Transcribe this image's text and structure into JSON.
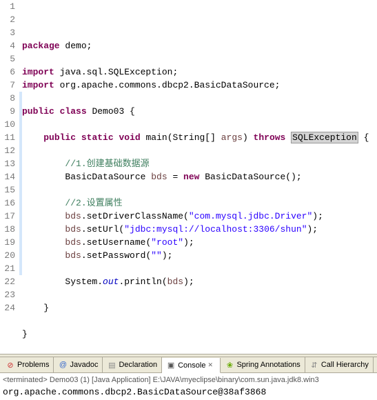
{
  "code": {
    "lines": [
      {
        "n": "1",
        "segs": [
          {
            "t": "package",
            "c": "kw"
          },
          {
            "t": " demo;"
          }
        ]
      },
      {
        "n": "2",
        "segs": []
      },
      {
        "n": "3",
        "segs": [
          {
            "t": "import",
            "c": "kw"
          },
          {
            "t": " java.sql.SQLException;"
          }
        ]
      },
      {
        "n": "4",
        "segs": [
          {
            "t": "import",
            "c": "kw"
          },
          {
            "t": " org.apache.commons.dbcp2.BasicDataSource;"
          }
        ]
      },
      {
        "n": "5",
        "segs": []
      },
      {
        "n": "6",
        "segs": [
          {
            "t": "public",
            "c": "kw"
          },
          {
            "t": " "
          },
          {
            "t": "class",
            "c": "kw"
          },
          {
            "t": " Demo03 {"
          }
        ]
      },
      {
        "n": "7",
        "segs": []
      },
      {
        "n": "8",
        "segs": [
          {
            "t": "    "
          },
          {
            "t": "public",
            "c": "kw"
          },
          {
            "t": " "
          },
          {
            "t": "static",
            "c": "kw"
          },
          {
            "t": " "
          },
          {
            "t": "void",
            "c": "kw"
          },
          {
            "t": " main(String[] "
          },
          {
            "t": "args",
            "c": "param"
          },
          {
            "t": ") "
          },
          {
            "t": "throws",
            "c": "kw"
          },
          {
            "t": " "
          },
          {
            "t": "SQLException",
            "c": "hl-box"
          },
          {
            "t": " {"
          }
        ]
      },
      {
        "n": "9",
        "segs": []
      },
      {
        "n": "10",
        "segs": [
          {
            "t": "        "
          },
          {
            "t": "//1.创建基础数据源",
            "c": "cmt"
          }
        ]
      },
      {
        "n": "11",
        "segs": [
          {
            "t": "        BasicDataSource "
          },
          {
            "t": "bds",
            "c": "param"
          },
          {
            "t": " = "
          },
          {
            "t": "new",
            "c": "kw"
          },
          {
            "t": " BasicDataSource();"
          }
        ]
      },
      {
        "n": "12",
        "segs": []
      },
      {
        "n": "13",
        "segs": [
          {
            "t": "        "
          },
          {
            "t": "//2.设置属性",
            "c": "cmt"
          }
        ]
      },
      {
        "n": "14",
        "segs": [
          {
            "t": "        "
          },
          {
            "t": "bds",
            "c": "param"
          },
          {
            "t": ".setDriverClassName("
          },
          {
            "t": "\"com.mysql.jdbc.Driver\"",
            "c": "str"
          },
          {
            "t": ");"
          }
        ]
      },
      {
        "n": "15",
        "segs": [
          {
            "t": "        "
          },
          {
            "t": "bds",
            "c": "param"
          },
          {
            "t": ".setUrl("
          },
          {
            "t": "\"jdbc:mysql://localhost:3306/shun\"",
            "c": "str"
          },
          {
            "t": ");"
          }
        ]
      },
      {
        "n": "16",
        "segs": [
          {
            "t": "        "
          },
          {
            "t": "bds",
            "c": "param"
          },
          {
            "t": ".setUsername("
          },
          {
            "t": "\"root\"",
            "c": "str"
          },
          {
            "t": ");"
          }
        ]
      },
      {
        "n": "17",
        "segs": [
          {
            "t": "        "
          },
          {
            "t": "bds",
            "c": "param"
          },
          {
            "t": ".setPassword("
          },
          {
            "t": "\"\"",
            "c": "str"
          },
          {
            "t": ");"
          }
        ]
      },
      {
        "n": "18",
        "segs": []
      },
      {
        "n": "19",
        "segs": [
          {
            "t": "        System."
          },
          {
            "t": "out",
            "c": "sfield"
          },
          {
            "t": ".println("
          },
          {
            "t": "bds",
            "c": "param"
          },
          {
            "t": ");"
          }
        ]
      },
      {
        "n": "20",
        "segs": []
      },
      {
        "n": "21",
        "segs": [
          {
            "t": "    }"
          }
        ]
      },
      {
        "n": "22",
        "segs": []
      },
      {
        "n": "23",
        "segs": [
          {
            "t": "}"
          }
        ]
      },
      {
        "n": "24",
        "segs": []
      }
    ]
  },
  "tabs": {
    "problems": "Problems",
    "javadoc": "Javadoc",
    "declaration": "Declaration",
    "console": "Console",
    "spring": "Spring Annotations",
    "callhier": "Call Hierarchy"
  },
  "console": {
    "term": "<terminated> Demo03 (1) [Java Application] E:\\JAVA\\myeclipse\\binary\\com.sun.java.jdk8.win3",
    "output": "org.apache.commons.dbcp2.BasicDataSource@38af3868"
  }
}
